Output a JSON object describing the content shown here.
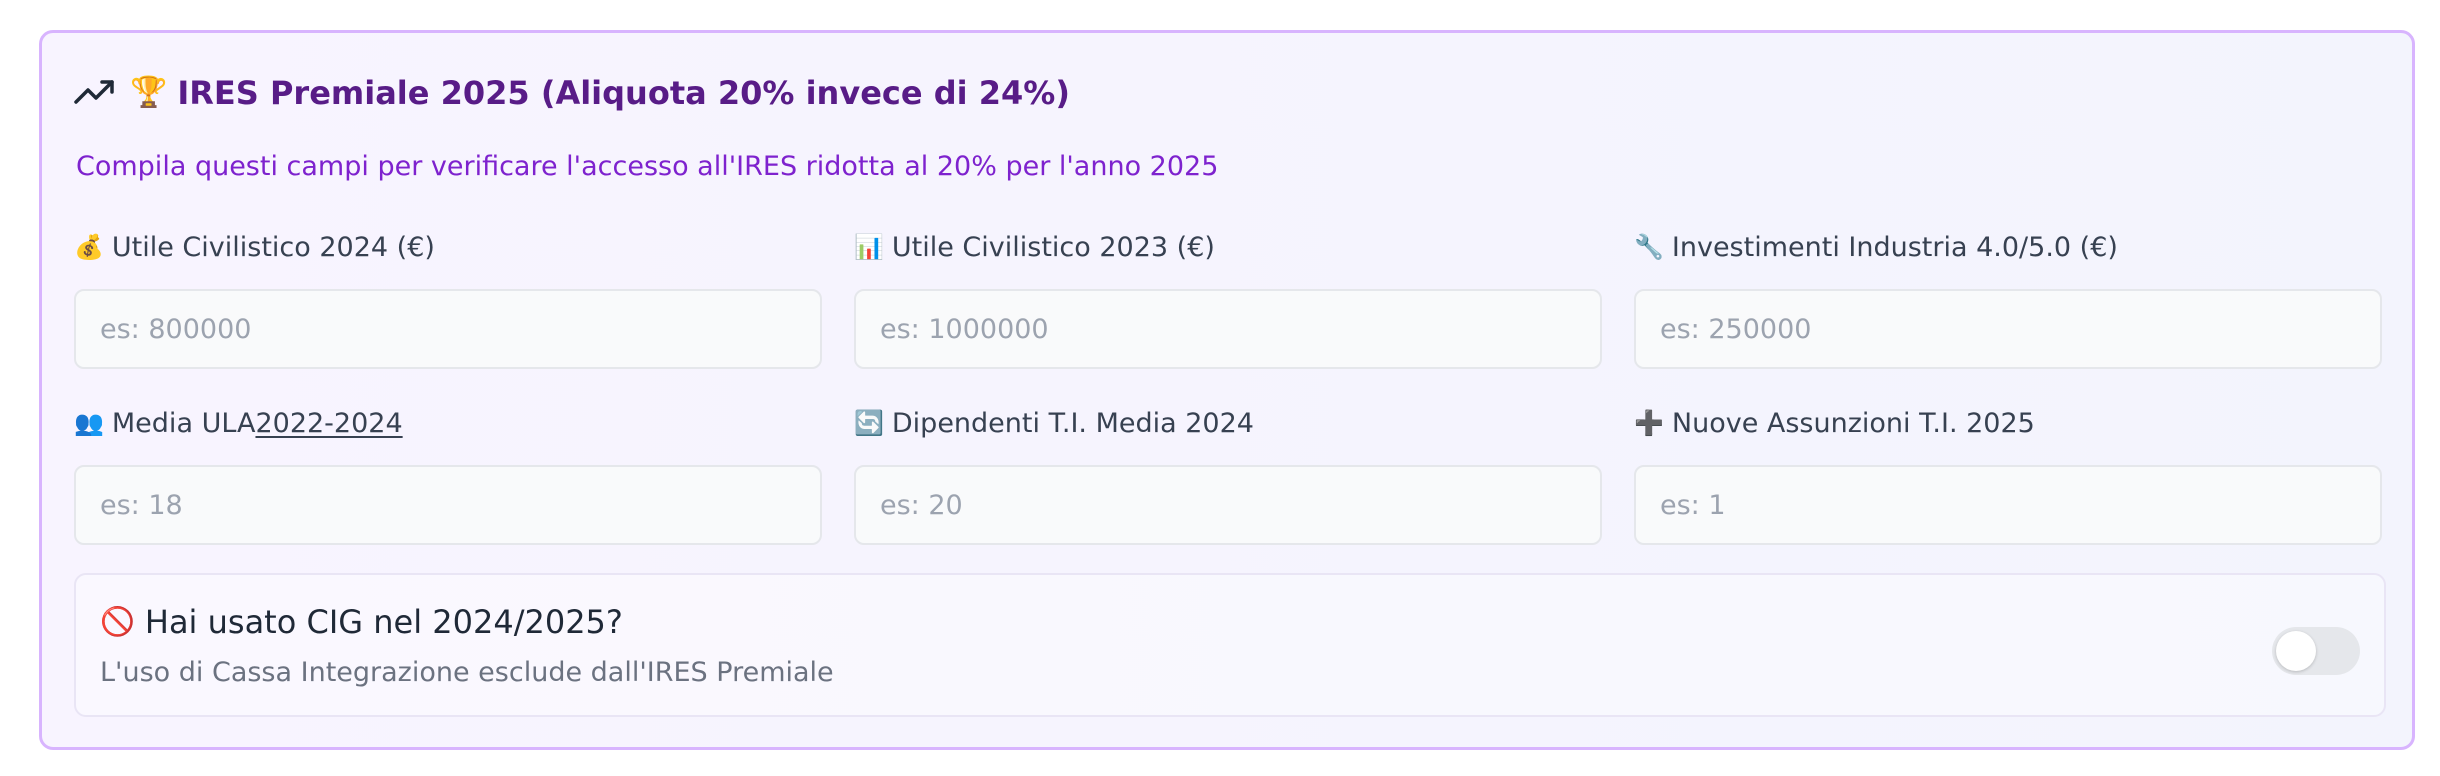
{
  "header": {
    "icon": "trending-up-icon",
    "trophy": "🏆",
    "title": "IRES Premiale 2025 (Aliquota 20% invece di 24%)",
    "subtitle": "Compila questi campi per verificare l'accesso all'IRES ridotta al 20% per l'anno 2025"
  },
  "fields": [
    {
      "emoji": "💰",
      "label": "Utile Civilistico 2024 (€)",
      "placeholder": "es: 800000"
    },
    {
      "emoji": "📊",
      "label": "Utile Civilistico 2023 (€)",
      "placeholder": "es: 1000000"
    },
    {
      "emoji": "🔧",
      "label": "Investimenti Industria 4.0/5.0 (€)",
      "placeholder": "es: 250000"
    },
    {
      "emoji": "👥",
      "label": "Media ULA",
      "label_underlined": " 2022-2024",
      "placeholder": "es: 18"
    },
    {
      "emoji": "🔄",
      "label": "Dipendenti T.I. Media 2024",
      "placeholder": "es: 20"
    },
    {
      "emoji": "➕",
      "label": "Nuove Assunzioni T.I. 2025",
      "placeholder": "es: 1"
    }
  ],
  "cig": {
    "emoji": "🚫",
    "title": "Hai usato CIG nel 2024/2025?",
    "description": "L'uso di Cassa Integrazione esclude dall'IRES Premiale",
    "enabled": false
  },
  "colors": {
    "card_border": "#d8b4fe",
    "title": "#581c87",
    "subtitle": "#7e22ce"
  }
}
